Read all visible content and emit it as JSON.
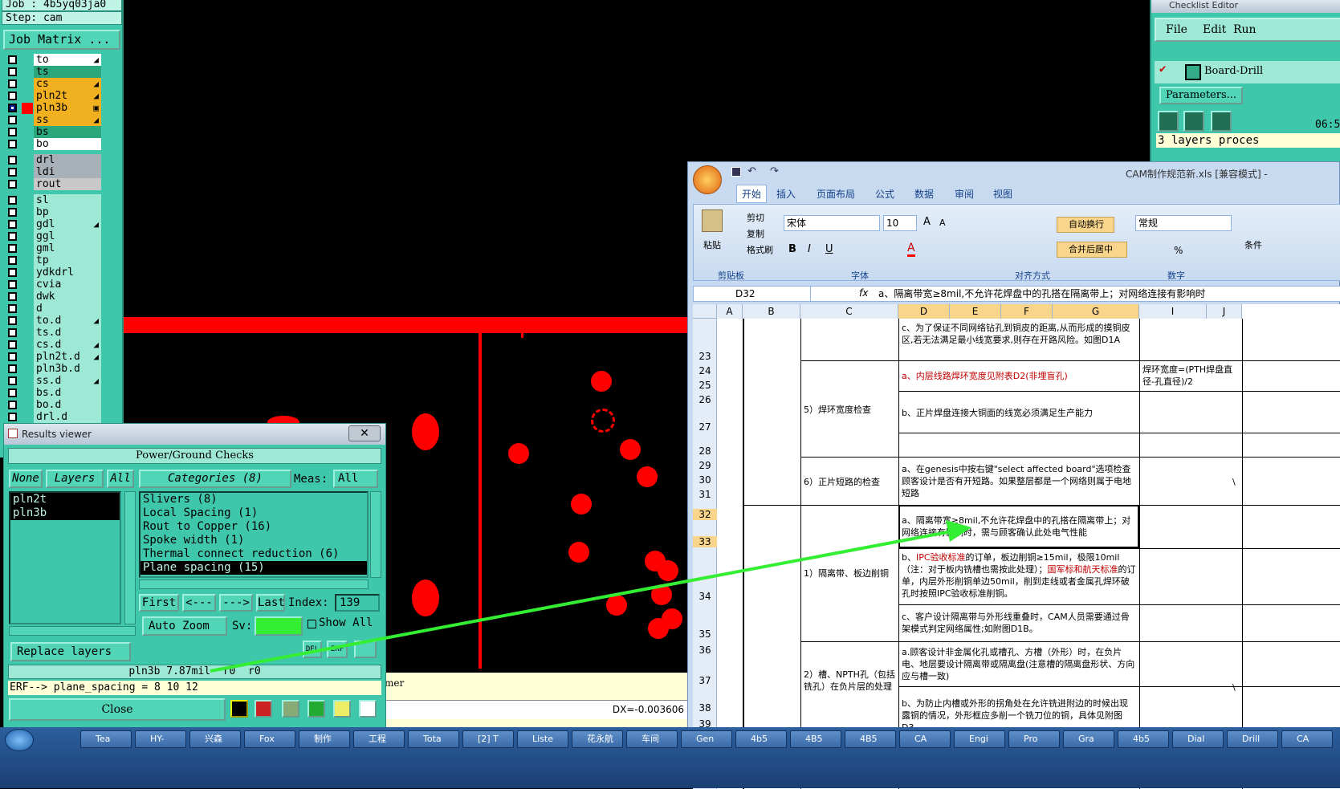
{
  "left_panel": {
    "job": "Job : 4b5yq03ja0",
    "step": "Step: cam",
    "job_matrix_button": "Job Matrix ...",
    "layers": [
      {
        "name": "to",
        "color": "#ffffff",
        "name_bg": "#ffffff",
        "mark": "◢",
        "checked": false
      },
      {
        "name": "ts",
        "color": "#2ba77c",
        "name_bg": "#2ba77c",
        "mark": "",
        "checked": false
      },
      {
        "name": "cs",
        "color": "#f0b020",
        "name_bg": "#f0b020",
        "mark": "◢",
        "checked": false
      },
      {
        "name": "pln2t",
        "color": "#f0b020",
        "name_bg": "#f0b020",
        "mark": "◢",
        "checked": false
      },
      {
        "name": "pln3b",
        "color": "#ff0000",
        "name_bg": "#f0b020",
        "mark": "▣",
        "checked": true
      },
      {
        "name": "ss",
        "color": "#f0b020",
        "name_bg": "#f0b020",
        "mark": "◢",
        "checked": false
      },
      {
        "name": "bs",
        "color": "#2ba77c",
        "name_bg": "#2ba77c",
        "mark": "",
        "checked": false
      },
      {
        "name": "bo",
        "color": "#ffffff",
        "name_bg": "#ffffff",
        "mark": "",
        "checked": false
      },
      {
        "name": "drl",
        "color": "#a8b0b8",
        "name_bg": "#a8b0b8",
        "mark": "",
        "checked": false
      },
      {
        "name": "ldi",
        "color": "#a8b0b8",
        "name_bg": "#a8b0b8",
        "mark": "",
        "checked": false
      },
      {
        "name": "rout",
        "color": "#c8c8c8",
        "name_bg": "#c8c8c8",
        "mark": "",
        "checked": false
      },
      {
        "name": "sl",
        "color": "#9ee8d6",
        "name_bg": "#9ee8d6",
        "mark": "",
        "checked": false
      },
      {
        "name": "bp",
        "color": "#9ee8d6",
        "name_bg": "#9ee8d6",
        "mark": "",
        "checked": false
      },
      {
        "name": "gdl",
        "color": "#9ee8d6",
        "name_bg": "#9ee8d6",
        "mark": "◢",
        "checked": false
      },
      {
        "name": "ggl",
        "color": "#9ee8d6",
        "name_bg": "#9ee8d6",
        "mark": "",
        "checked": false
      },
      {
        "name": "gml",
        "color": "#9ee8d6",
        "name_bg": "#9ee8d6",
        "mark": "",
        "checked": false
      },
      {
        "name": "tp",
        "color": "#9ee8d6",
        "name_bg": "#9ee8d6",
        "mark": "",
        "checked": false
      },
      {
        "name": "ydkdrl",
        "color": "#9ee8d6",
        "name_bg": "#9ee8d6",
        "mark": "",
        "checked": false
      },
      {
        "name": "cvia",
        "color": "#9ee8d6",
        "name_bg": "#9ee8d6",
        "mark": "",
        "checked": false
      },
      {
        "name": "dwk",
        "color": "#9ee8d6",
        "name_bg": "#9ee8d6",
        "mark": "",
        "checked": false
      },
      {
        "name": "d",
        "color": "#9ee8d6",
        "name_bg": "#9ee8d6",
        "mark": "",
        "checked": false
      },
      {
        "name": "to.d",
        "color": "#9ee8d6",
        "name_bg": "#9ee8d6",
        "mark": "◢",
        "checked": false
      },
      {
        "name": "ts.d",
        "color": "#9ee8d6",
        "name_bg": "#9ee8d6",
        "mark": "",
        "checked": false
      },
      {
        "name": "cs.d",
        "color": "#9ee8d6",
        "name_bg": "#9ee8d6",
        "mark": "◢",
        "checked": false
      },
      {
        "name": "pln2t.d",
        "color": "#9ee8d6",
        "name_bg": "#9ee8d6",
        "mark": "◢",
        "checked": false
      },
      {
        "name": "pln3b.d",
        "color": "#9ee8d6",
        "name_bg": "#9ee8d6",
        "mark": "",
        "checked": false
      },
      {
        "name": "ss.d",
        "color": "#9ee8d6",
        "name_bg": "#9ee8d6",
        "mark": "◢",
        "checked": false
      },
      {
        "name": "bs.d",
        "color": "#9ee8d6",
        "name_bg": "#9ee8d6",
        "mark": "",
        "checked": false
      },
      {
        "name": "bo.d",
        "color": "#9ee8d6",
        "name_bg": "#9ee8d6",
        "mark": "",
        "checked": false
      },
      {
        "name": "drl.d",
        "color": "#9ee8d6",
        "name_bg": "#9ee8d6",
        "mark": "",
        "checked": false
      }
    ]
  },
  "results_viewer": {
    "title": "Results viewer",
    "close_x": "✕",
    "check_title": "Power/Ground Checks",
    "btn_none": "None",
    "btn_layers": "Layers",
    "btn_all": "All",
    "categories_btn": "Categories (8)",
    "meas_label": "Meas:",
    "meas_value": "All",
    "layer_list": [
      "pln2t",
      "pln3b"
    ],
    "categories": [
      {
        "label": "Slivers (8)",
        "selected": false
      },
      {
        "label": "Local Spacing (1)",
        "selected": false
      },
      {
        "label": "Rout to Copper (16)",
        "selected": false
      },
      {
        "label": "Spoke width (1)",
        "selected": false
      },
      {
        "label": "Thermal connect reduction (6)",
        "selected": false
      },
      {
        "label": "Plane spacing (15)",
        "selected": true
      }
    ],
    "nav_first": "First",
    "nav_prev": "<---",
    "nav_next": "--->",
    "nav_last": "Last",
    "index_label": "Index:",
    "index_value": "139",
    "auto_zoom": "Auto Zoom",
    "sv_label": "Sv:",
    "show_all": "Show All",
    "replace_layers": "Replace layers",
    "del_btn": "DEL",
    "erf_btn": "ERF",
    "status_line": "pln3b 7.87mil  r0  r0",
    "erf_line": "ERF--> plane_spacing = 8 10 12",
    "close_btn": "Close"
  },
  "canvas": {
    "bottom_text_mer": "mer",
    "dx_readout": "DX=-0.003606"
  },
  "checklist": {
    "title": "Checklist Editor",
    "menu_file": "File",
    "menu_edit": "Edit",
    "menu_run": "Run",
    "item": "Board-Drill",
    "parameters": "Parameters...",
    "time": "06:5",
    "status": "3 layers proces"
  },
  "excel": {
    "title": "CAM制作规范新.xls  [兼容模式] -",
    "tabs": [
      "开始",
      "插入",
      "页面布局",
      "公式",
      "数据",
      "审阅",
      "视图"
    ],
    "clipboard": {
      "cut": "剪切",
      "copy": "复制",
      "paste": "粘贴",
      "format": "格式刷",
      "group": "剪贴板"
    },
    "font_name": "宋体",
    "font_size": "10",
    "font_group": "字体",
    "wrap_text": "自动换行",
    "merge_center": "合并后居中",
    "align_group": "对齐方式",
    "number_format": "常规",
    "number_group": "数字",
    "conditional": "条件",
    "name_box": "D32",
    "fx": "fx",
    "formula": "a、隔离带宽≥8mil,不允许花焊盘中的孔搭在隔离带上；对网络连接有影响时",
    "columns": [
      "A",
      "B",
      "C",
      "D",
      "E",
      "F",
      "G",
      "I",
      "J"
    ],
    "rows": [
      "23",
      "24",
      "25",
      "26",
      "27",
      "28",
      "29",
      "30",
      "31",
      "32",
      "33",
      "34",
      "35",
      "36",
      "37",
      "38",
      "39"
    ],
    "cells": {
      "c23": "c、为了保证不同网络钻孔到铜皮的距离,从而形成的摸铜皮区,若无法满足最小线宽要求,则存在开路风险。如图D1A",
      "c24": "a、内层线路焊环宽度见附表D2(非埋盲孔)",
      "i24": "焊环宽度=(PTH焊盘直径-孔直径)/2",
      "b25": "5）焊环宽度检查",
      "c27": "b、正片焊盘连接大铜面的线宽必须满足生产能力",
      "b30": "6）正片短路的检查",
      "c29": "a、在genesis中按右键\"select affected board\"选项检查顾客设计是否有开短路。如果整层都是一个网络则属于电地短路",
      "j30": "\\",
      "c32": "a、隔离带宽≥8mil,不允许花焊盘中的孔搭在隔离带上；对网络连接有影响时，需与顾客确认此处电气性能",
      "b34": "1）隔离带、板边削铜",
      "c34a": "b、",
      "c34red1": "IPC验收标准",
      "c34b": "的订单，板边削铜≥15mil，极限10mil（注：对于板内铣槽也需按此处理）；",
      "c34red2": "国军标和航天标准",
      "c34c": "的订单，内层外形削铜单边50mil，削到走线或者金属孔焊环破孔时按照IPC验收标准削铜。",
      "c35": "c、客户设计隔离带与外形线重叠时，CAM人员需要通过骨架模式判定网络属性;如附图D1B。",
      "c36": "a.顾客设计非金属化孔或槽孔、方槽（外形）时，在负片电、地层要设计隔离带或隔离盘(注意槽的隔离盘形状、方向应与槽一致)",
      "b37": "2）槽、NPTH孔（包括铣孔）在负片层的处理",
      "j37": "\\",
      "c38": "b、为防止内槽或外形的拐角处在允许铣进附边的时候出现露铜的情况，外形框应多削一个铣刀位的铜，具体见附图D3。"
    }
  },
  "taskbar": {
    "items": [
      "Tea",
      "HY-",
      "兴森",
      "Fox",
      "制作",
      "工程",
      "Tota",
      "[2] T",
      "Liste",
      "花永航",
      "车间",
      "Gen",
      "4b5",
      "4B5",
      "4B5",
      "CA",
      "Engi",
      "Pro",
      "Gra",
      "4b5",
      "Dial",
      "Drill",
      "CA"
    ]
  },
  "colors": {
    "genesis_bg": "#3fc7ac",
    "plane_red": "#ff0000",
    "arrow_green": "#33ee33",
    "excel_ribbon": "#c8daf0"
  }
}
